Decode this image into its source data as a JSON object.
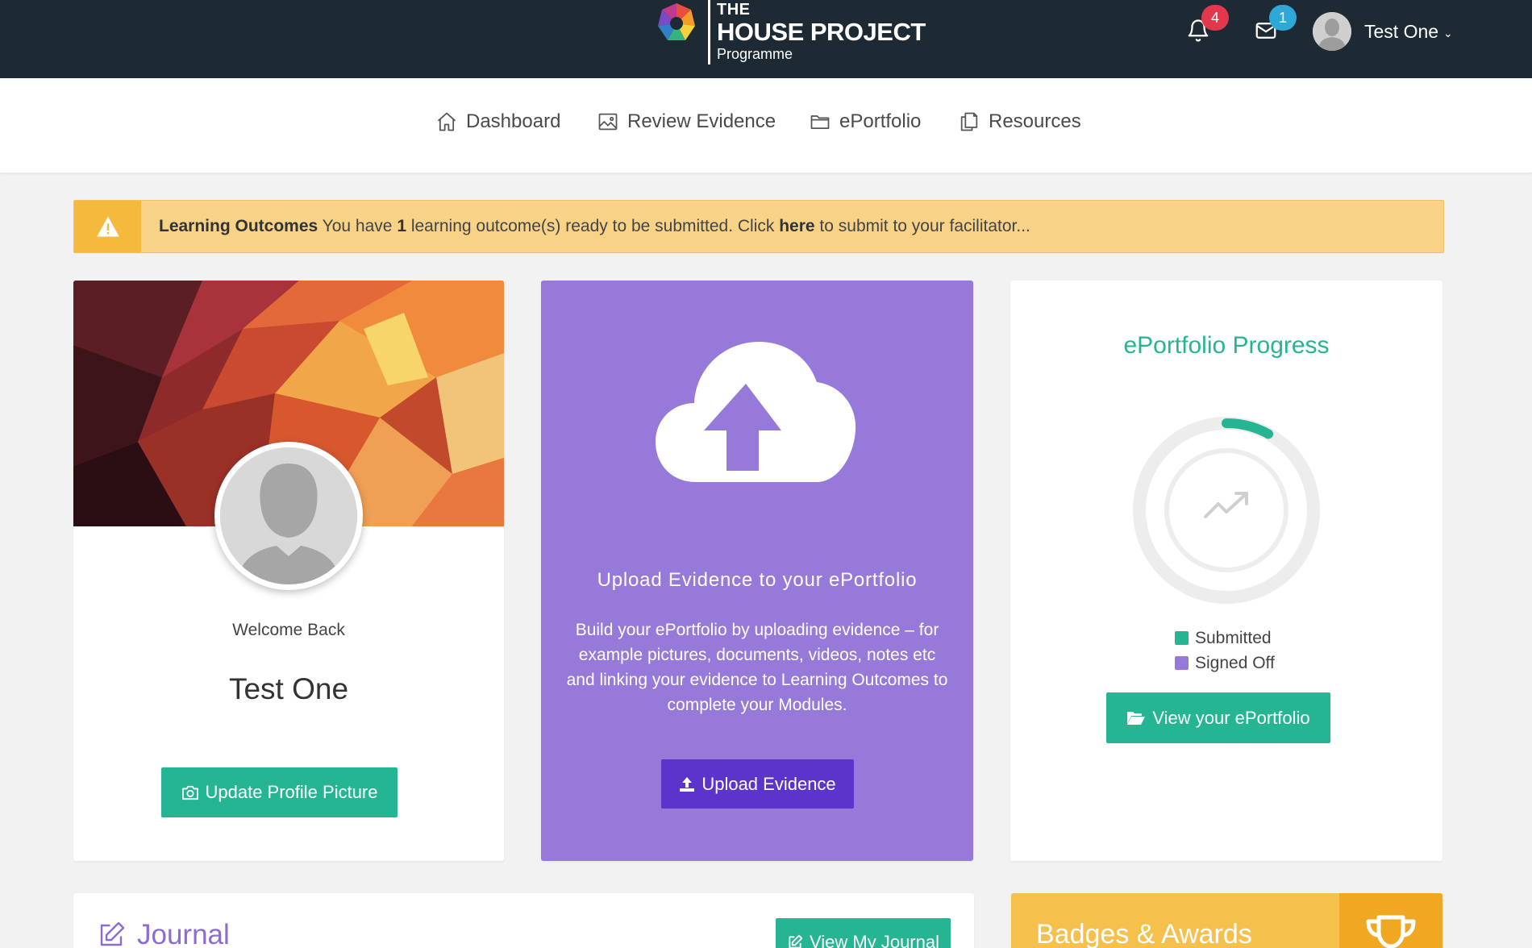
{
  "header": {
    "logo": {
      "line1": "THE",
      "line2": "HOUSE PROJECT",
      "line3": "Programme"
    },
    "notifications_count": "4",
    "messages_count": "1",
    "user_name": "Test One",
    "caret": "⌄"
  },
  "nav": {
    "items": [
      {
        "label": "Dashboard",
        "icon": "home-icon"
      },
      {
        "label": "Review Evidence",
        "icon": "image-icon"
      },
      {
        "label": "ePortfolio",
        "icon": "folder-icon"
      },
      {
        "label": "Resources",
        "icon": "copy-icon"
      }
    ]
  },
  "alert": {
    "title": "Learning Outcomes",
    "text_before": " You have ",
    "count": "1",
    "text_middle": " learning outcome(s) ready to be submitted. Click ",
    "link": "here",
    "text_after": " to submit to your facilitator..."
  },
  "profile": {
    "welcome": "Welcome Back",
    "name": "Test One",
    "button_label": "Update Profile Picture"
  },
  "upload": {
    "title": "Upload Evidence to your ePortfolio",
    "description": "Build your ePortfolio by uploading evidence – for example pictures, documents, videos, notes etc and linking your evidence to Learning Outcomes to complete your Modules.",
    "button_label": "Upload Evidence"
  },
  "progress": {
    "title": "ePortfolio Progress",
    "legend": [
      {
        "label": "Submitted",
        "color": "#26b592"
      },
      {
        "label": "Signed Off",
        "color": "#9779d9"
      }
    ],
    "submitted_fraction": 0.08,
    "signed_off_fraction": 0,
    "button_label": "View your ePortfolio"
  },
  "journal": {
    "title": "Journal",
    "button_label": "View My Journal"
  },
  "badges": {
    "title": "Badges & Awards"
  },
  "colors": {
    "topbar": "#1e2a33",
    "accent_green": "#26b592",
    "accent_purple": "#9779d9",
    "upload_button": "#5c34cc",
    "alert_bg": "#f8d286",
    "badges_bg": "#f6c04d"
  }
}
